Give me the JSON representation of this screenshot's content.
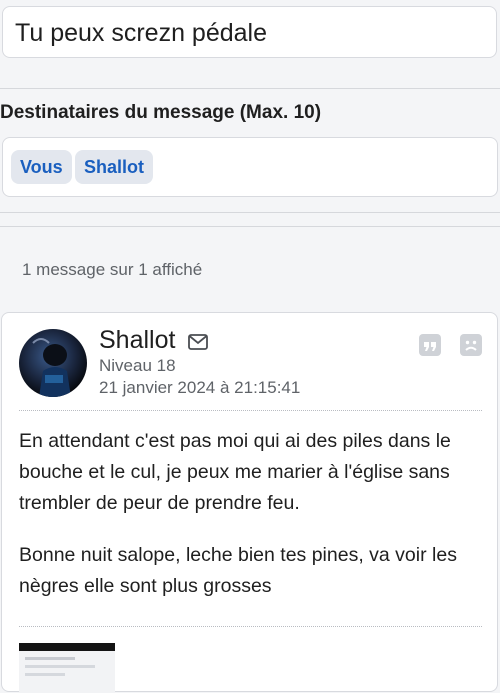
{
  "subject": {
    "value": "Tu peux screzn pédale"
  },
  "recipients": {
    "title": "Destinataires du message (Max. 10)",
    "chips": [
      "Vous",
      "Shallot"
    ]
  },
  "message_count": "1 message sur 1 affiché",
  "message": {
    "author": "Shallot",
    "level": "Niveau 18",
    "date": "21 janvier 2024 à 21:15:41",
    "paragraphs": [
      "En attendant c'est pas moi qui ai des piles dans le bouche et le cul, je peux me marier à l'église sans trembler de peur de prendre feu.",
      "Bonne nuit salope, leche bien tes pines, va voir les nègres elle sont plus grosses"
    ],
    "icons": [
      "mail-icon",
      "quote-icon",
      "sad-face-icon"
    ]
  },
  "colors": {
    "accent": "#1a5fbf",
    "chip_bg": "#e3e7ee",
    "page_bg": "#f4f5f7"
  }
}
